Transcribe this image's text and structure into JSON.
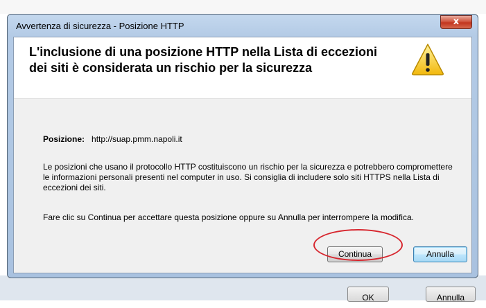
{
  "window": {
    "title": "Avvertenza di sicurezza - Posizione HTTP",
    "close_glyph": "x"
  },
  "header": {
    "heading": "L'inclusione di una posizione HTTP nella Lista di eccezioni dei siti è considerata un rischio per la sicurezza",
    "icon": "warning-icon",
    "icon_color": "#f4c430"
  },
  "content": {
    "position_label": "Posizione:",
    "position_value": "http://suap.pmm.napoli.it",
    "paragraph1": "Le posizioni che usano il protocollo HTTP costituiscono un rischio per la sicurezza e potrebbero compromettere le informazioni personali presenti nel computer in uso. Si consiglia di includere solo siti HTTPS nella Lista di eccezioni dei siti.",
    "paragraph2": "Fare clic su Continua per accettare questa posizione oppure su Annulla per interrompere la modifica."
  },
  "buttons": {
    "continue_label": "Continua",
    "cancel_label": "Annulla"
  },
  "background": {
    "button1_label": "OK",
    "button2_label": "Annulla"
  },
  "colors": {
    "highlight_ring": "#d7262e",
    "default_button_border": "#3c7fb1"
  }
}
